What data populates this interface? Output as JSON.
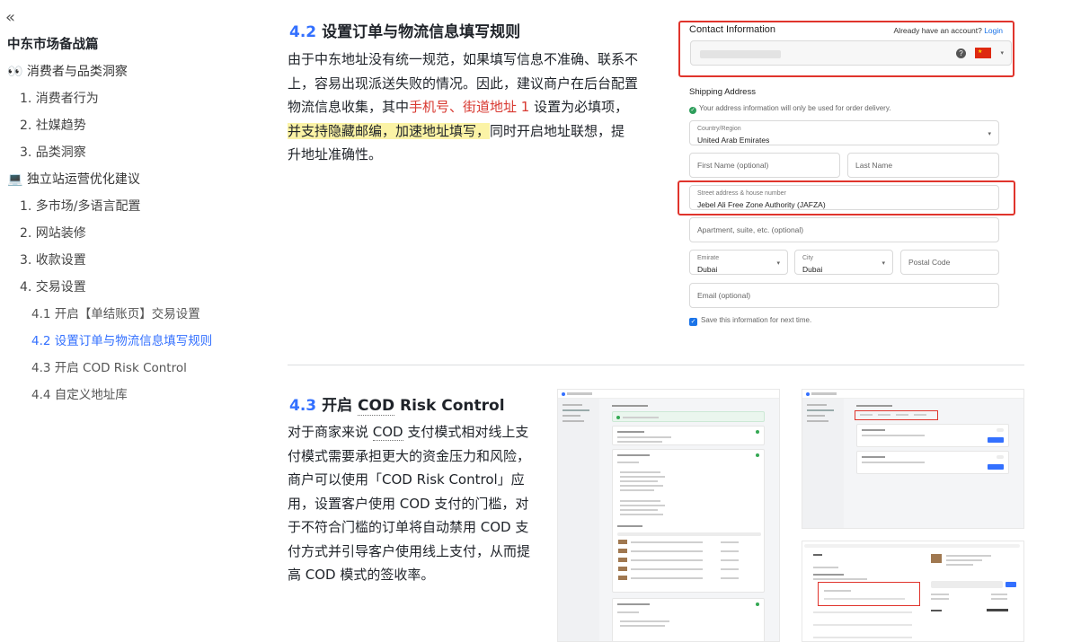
{
  "sidebar": {
    "collapse_icon": "«",
    "items": [
      {
        "label": "中东市场备战篇",
        "level": "h1"
      },
      {
        "label": "👀 消费者与品类洞察",
        "level": "h2"
      },
      {
        "label": "1. 消费者行为",
        "level": "h3"
      },
      {
        "label": "2. 社媒趋势",
        "level": "h3"
      },
      {
        "label": "3. 品类洞察",
        "level": "h3"
      },
      {
        "label": "💻 独立站运营优化建议",
        "level": "h2"
      },
      {
        "label": "1. 多市场/多语言配置",
        "level": "h3"
      },
      {
        "label": "2. 网站装修",
        "level": "h3"
      },
      {
        "label": "3. 收款设置",
        "level": "h3"
      },
      {
        "label": "4. 交易设置",
        "level": "h3"
      },
      {
        "label": "4.1 开启【单结账页】交易设置",
        "level": "h4"
      },
      {
        "label": "4.2 设置订单与物流信息填写规则",
        "level": "h4",
        "active": true
      },
      {
        "label": "4.3 开启 COD Risk Control",
        "level": "h4"
      },
      {
        "label": "4.4 自定义地址库",
        "level": "h4"
      }
    ]
  },
  "section42": {
    "num": "4.2",
    "title": "设置订单与物流信息填写规则",
    "p_a": "由于中东地址没有统一规范，如果填写信息不准确、联系不上，容易出现派送失败的情况。因此，建议商户在后台配置物流信息收集，其中",
    "p_red": "手机号、街道地址 1",
    "p_b": " 设置为必填项，",
    "p_hl": "并支持隐藏邮编，加速地址填写，",
    "p_c": "同时开启地址联想，提升地址准确性。"
  },
  "section43": {
    "num": "4.3",
    "title_a": "开启 ",
    "title_b": "COD",
    "title_c": " Risk Control",
    "p_a": "对于商家来说 ",
    "p_cod": "COD",
    "p_b": " 支付模式相对线上支付模式需要承担更大的资金压力和风险，商户可以使用「COD Risk Control」应用，设置客户使用 COD 支付的门槛，对于不符合门槛的订单将自动禁用 COD 支付方式并引导客户使用线上支付，从而提高 COD 模式的签收率。"
  },
  "form": {
    "contact_title": "Contact Information",
    "login_prompt": "Already have an account?",
    "login_link": "Login",
    "shipping_title": "Shipping Address",
    "shipping_note": "Your address information will only be used for order delivery.",
    "country_label": "Country/Region",
    "country_value": "United Arab Emirates",
    "first_name_ph": "First Name (optional)",
    "last_name_ph": "Last Name",
    "street_label": "Street address & house number",
    "street_value": "Jebel Ali Free Zone Authority (JAFZA)",
    "apartment_ph": "Apartment, suite, etc. (optional)",
    "emirate_label": "Emirate",
    "emirate_value": "Dubai",
    "city_label": "City",
    "city_value": "Dubai",
    "postal_ph": "Postal Code",
    "email_ph": "Email (optional)",
    "save_label": "Save this information for next time."
  },
  "colors": {
    "accent": "#3370ff",
    "red_text": "#d83931",
    "highlight": "#fbf3a6",
    "red_box": "#e0342c"
  }
}
